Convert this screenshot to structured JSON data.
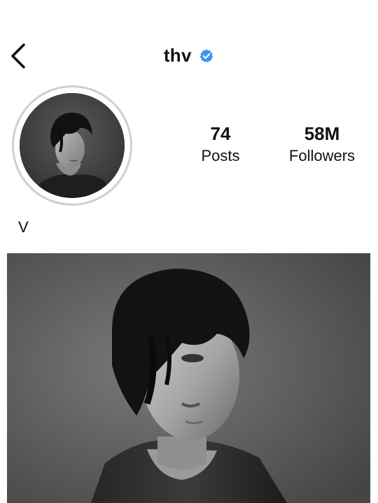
{
  "header": {
    "username": "thv",
    "back_icon": "chevron-left-icon",
    "verified_icon": "verified-badge-icon",
    "verified_color": "#3897f0"
  },
  "profile": {
    "display_name": "V",
    "avatar_icon": "profile-photo"
  },
  "stats": {
    "posts_count": "74",
    "posts_label": "Posts",
    "followers_count": "58M",
    "followers_label": "Followers"
  },
  "feed": {
    "post_image": "grayscale-portrait-photo"
  },
  "colors": {
    "text": "#111111",
    "ring": "#cfcfcf",
    "background": "#ffffff"
  }
}
